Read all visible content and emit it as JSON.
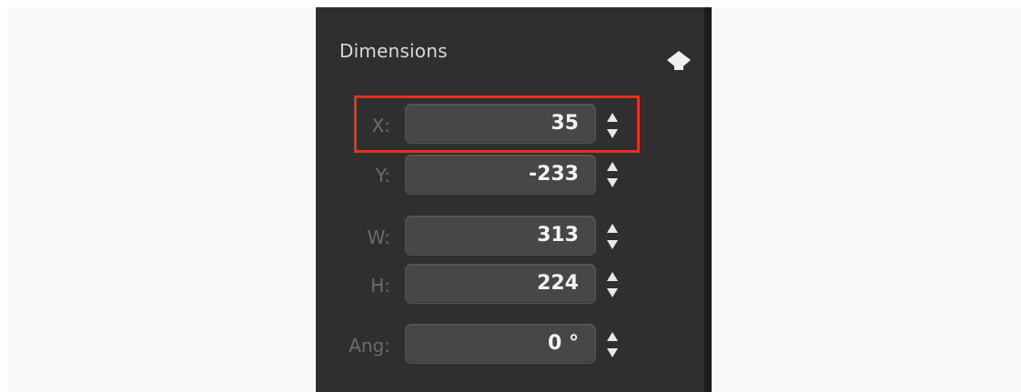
{
  "panel": {
    "title": "Dimensions",
    "collapse_icon": "pin-diamond-icon",
    "colors": {
      "panel_bg": "#2f2f2f",
      "field_bg": "#474747",
      "label": "#6b6b6b",
      "value": "#f2f2f2",
      "highlight": "#e5311f"
    },
    "fields": {
      "x": {
        "label": "X:",
        "value": "35"
      },
      "y": {
        "label": "Y:",
        "value": "-233"
      },
      "w": {
        "label": "W:",
        "value": "313"
      },
      "h": {
        "label": "H:",
        "value": "224"
      },
      "ang": {
        "label": "Ang:",
        "value": "0 °"
      }
    },
    "stepper_icon": "up-down-arrows-icon"
  }
}
